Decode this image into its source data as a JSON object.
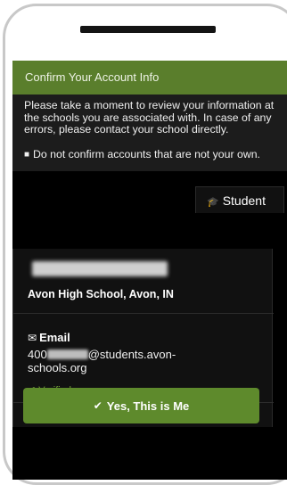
{
  "header": {
    "title": "Confirm Your Account Info"
  },
  "info": {
    "message": "Please take a moment to review your information at the schools you are associated with. In case of any errors, please contact your school directly.",
    "bullet_text": "Do not confirm accounts that are not your own."
  },
  "tab": {
    "label": "Student",
    "icon": "graduation-cap-icon"
  },
  "account": {
    "school": "Avon High School, Avon, IN",
    "email_label": "Email",
    "email_icon": "envelope-icon",
    "email_prefix": "400",
    "email_suffix": "@students.avon-schools.org",
    "verified_label": "Verified"
  },
  "actions": {
    "confirm_label": "Yes, This is Me"
  },
  "colors": {
    "accent": "#5a7e2c",
    "verified": "#6e9a35"
  }
}
